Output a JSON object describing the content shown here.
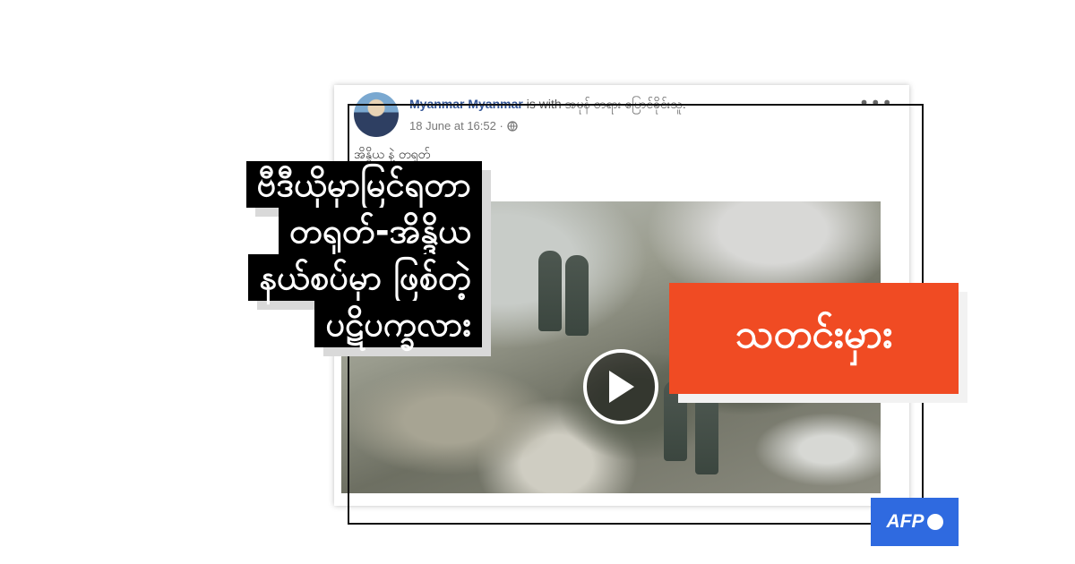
{
  "post": {
    "poster_name": "Myanmar Myanmar",
    "with_text": "is with",
    "tagged": "အမုန် တရား ပြောင်ခိုင်းသူ.",
    "timestamp": "18 June at 16:52 ·",
    "privacy_icon": "globe-icon",
    "more_icon": "ellipsis-icon",
    "caption": "အိန္ဒိယ နဲ့ တရုတ်"
  },
  "video": {
    "play_icon": "play-icon"
  },
  "headline": {
    "lines": [
      "ဗီဒီယိုမှာမြင်ရတာ",
      "တရုတ်-အိန္ဒိယ",
      "နယ်စပ်မှာ ဖြစ်တဲ့",
      "ပဋိပက္ခလား"
    ]
  },
  "verdict": {
    "label": "သတင်းမှား",
    "color": "#f04b23"
  },
  "brand": {
    "logo_text": "AFP",
    "color": "#2f6ae0"
  }
}
